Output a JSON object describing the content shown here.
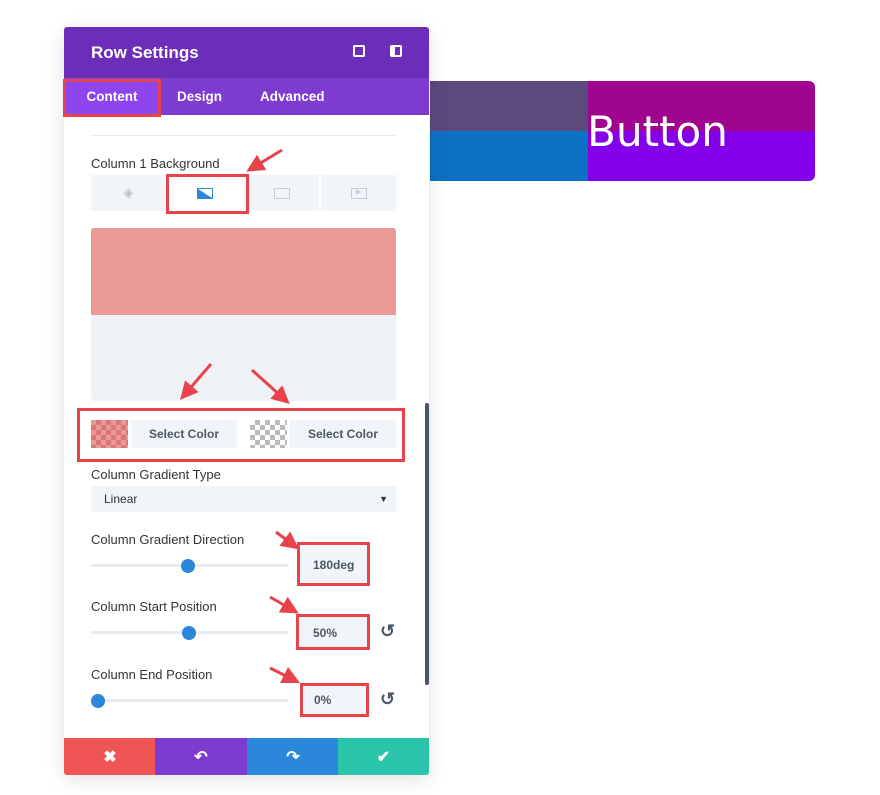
{
  "preview": {
    "button_label": "Button",
    "colors": {
      "top_left": "#5c4a7d",
      "top_right": "#a0058f",
      "bottom_left": "#0c71c3",
      "bottom_right": "#8300e9"
    }
  },
  "panel": {
    "title": "Row Settings",
    "header_icons": [
      "focus-icon",
      "sidebar-toggle-icon"
    ],
    "tabs": [
      {
        "label": "Content",
        "active": true
      },
      {
        "label": "Design"
      },
      {
        "label": "Advanced"
      }
    ],
    "background_label": "Column 1 Background",
    "background_tabs": [
      "color-icon",
      "gradient-icon",
      "image-icon",
      "video-icon"
    ],
    "active_background_tab": "gradient",
    "gradient_preview": {
      "top_color": "#e99a97",
      "bottom_color": "#eef1f6"
    },
    "color_stops": [
      {
        "label": "Select Color",
        "swatch": "#e99a97"
      },
      {
        "label": "Select Color",
        "swatch": "transparent"
      }
    ],
    "gradient_type": {
      "label": "Column Gradient Type",
      "value": "Linear"
    },
    "gradient_direction": {
      "label": "Column Gradient Direction",
      "value": "180deg",
      "slider": 0.5
    },
    "start_position": {
      "label": "Column Start Position",
      "value": "50%",
      "slider": 0.5
    },
    "end_position": {
      "label": "Column End Position",
      "value": "0%",
      "slider": 0
    },
    "footer": {
      "colors": [
        "#ef5555",
        "#7e3bd0",
        "#2b87da",
        "#29c4a9"
      ],
      "icons": [
        "close-icon",
        "undo-icon",
        "redo-icon",
        "check-icon"
      ]
    }
  }
}
